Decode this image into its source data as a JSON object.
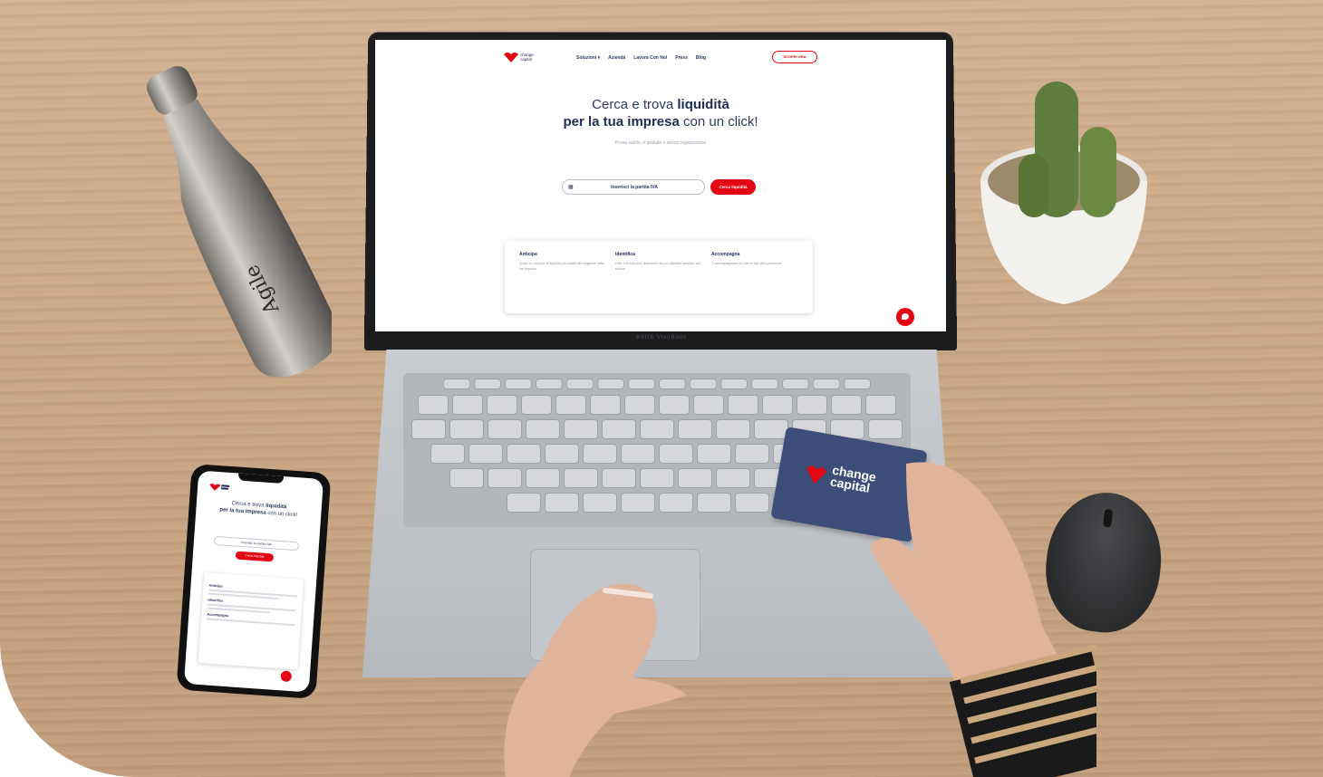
{
  "site": {
    "logo_text": "change capital",
    "nav": [
      "Soluzioni ▾",
      "Azienda",
      "Lavora Con Noi",
      "Press",
      "Blog"
    ],
    "nav_button": "SCOPRI ORA",
    "hero_line1_normal": "Cerca e trova ",
    "hero_line1_bold": "liquidità",
    "hero_line2_bold": "per la tua impresa",
    "hero_line2_normal": " con un click!",
    "hero_sub": "Prova subito, è gratuito e senza registrazione",
    "search_placeholder": "Inserisci la partita IVA",
    "search_button": "Cerca liquidità",
    "features": [
      {
        "title": "Anticipa",
        "text": "Scopri le soluzioni di liquidità più adatte alle esigenze della tua impresa."
      },
      {
        "title": "Identifica",
        "text": "Oltre 100 soluzioni finanziarie dai più affidabili operatori del settore."
      },
      {
        "title": "Accompagna",
        "text": "Ti accompagniamo in tutte le fasi dell'operazione."
      }
    ]
  },
  "laptop_brand": "ASUS VivoBook",
  "bottle_text": "Agile",
  "gift_card": {
    "line1": "change",
    "line2": "capital"
  },
  "colors": {
    "brand_red": "#e30613",
    "brand_navy": "#1f2d55",
    "card_blue": "#3b4d78"
  }
}
